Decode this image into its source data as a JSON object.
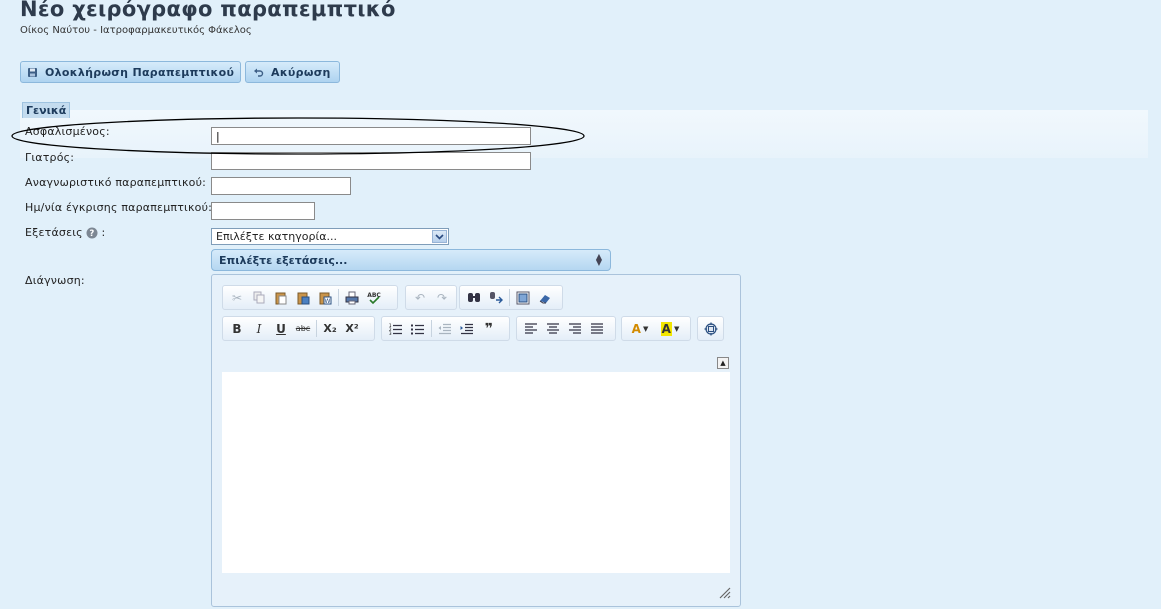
{
  "page": {
    "title": "Νέο χειρόγραφο παραπεμπτικό",
    "subtitle": "Οίκος Ναύτου - Ιατροφαρμακευτικός Φάκελος"
  },
  "toolbar": {
    "complete_label": "Ολοκλήρωση Παραπεμπτικού",
    "cancel_label": "Ακύρωση"
  },
  "section": {
    "title": "Γενικά"
  },
  "form": {
    "insured_label": "Ασφαλισμένος:",
    "insured_value": "|",
    "doctor_label": "Γιατρός:",
    "doctor_value": "",
    "referral_id_label": "Αναγνωριστικό παραπεμπτικού:",
    "referral_id_value": "",
    "approval_date_label": "Ημ/νία έγκρισης παραπεμπτικού:",
    "approval_date_value": "",
    "exams_label": "Εξετάσεις",
    "exams_colon": " :",
    "category_selected": "Επιλέξτε κατηγορία...",
    "exams_selected": "Επιλέξτε εξετάσεις...",
    "diagnosis_label": "Διάγνωση:"
  },
  "editor": {
    "row1": [
      "cut-icon",
      "copy-icon",
      "paste-icon",
      "paste-text-icon",
      "paste-word-icon",
      "print-icon",
      "spellcheck-icon",
      "undo-icon",
      "redo-icon",
      "find-icon",
      "replace-icon",
      "select-all-icon",
      "remove-format-icon"
    ],
    "row2": [
      "bold-icon",
      "italic-icon",
      "underline-icon",
      "strike-icon",
      "subscript-icon",
      "superscript-icon",
      "numbered-list-icon",
      "bulleted-list-icon",
      "outdent-icon",
      "indent-icon",
      "blockquote-icon",
      "align-left-icon",
      "align-center-icon",
      "align-right-icon",
      "justify-icon",
      "text-color-icon",
      "bg-color-icon",
      "maximize-icon"
    ],
    "bold_glyph": "B",
    "italic_glyph": "I",
    "underline_glyph": "U",
    "strike_glyph": "abc",
    "subscript_glyph": "X₂",
    "superscript_glyph": "X²",
    "quote_glyph": "❞",
    "text_color_glyph": "A",
    "bg_color_glyph": "A",
    "spell_glyph": "ABC"
  },
  "colors": {
    "background": "#e1f0fa",
    "title": "#2e3b4c",
    "button_text": "#1d3b5c",
    "ellipse": "#000000"
  }
}
